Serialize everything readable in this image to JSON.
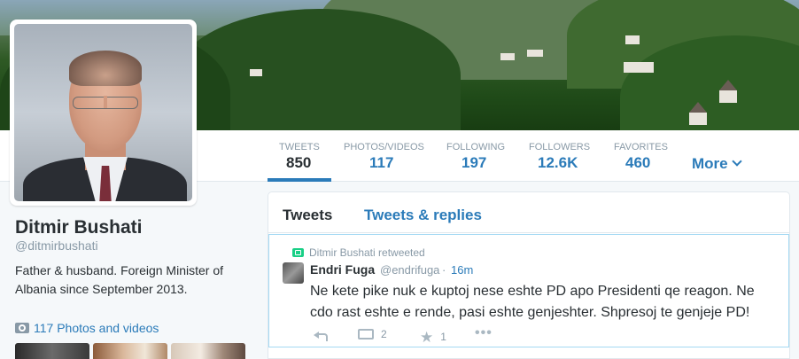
{
  "profile": {
    "name": "Ditmir Bushati",
    "handle": "@ditmirbushati",
    "bio": "Father & husband. Foreign Minister of Albania since September 2013.",
    "photos_link": "117 Photos and videos"
  },
  "nav": {
    "stats": [
      {
        "label": "TWEETS",
        "value": "850"
      },
      {
        "label": "PHOTOS/VIDEOS",
        "value": "117"
      },
      {
        "label": "FOLLOWING",
        "value": "197"
      },
      {
        "label": "FOLLOWERS",
        "value": "12.6K"
      },
      {
        "label": "FAVORITES",
        "value": "460"
      }
    ],
    "more_label": "More"
  },
  "timeline": {
    "tabs": [
      "Tweets",
      "Tweets & replies"
    ],
    "tweet": {
      "retweeted_by": "Ditmir Bushati retweeted",
      "author_name": "Endri Fuga",
      "author_handle": "@endrifuga",
      "separator": "·",
      "time": "16m",
      "text": "Ne kete pike nuk e kuptoj nese eshte PD apo Presidenti qe reagon. Ne cdo rast eshte e rende, pasi eshte genjeshter. Shpresoj te genjeje PD!",
      "retweet_count": "2",
      "favorite_count": "1"
    }
  },
  "colors": {
    "link": "#2b7bb9",
    "muted": "#8899a6",
    "text": "#292f33",
    "retweet_green": "#19cf86"
  }
}
